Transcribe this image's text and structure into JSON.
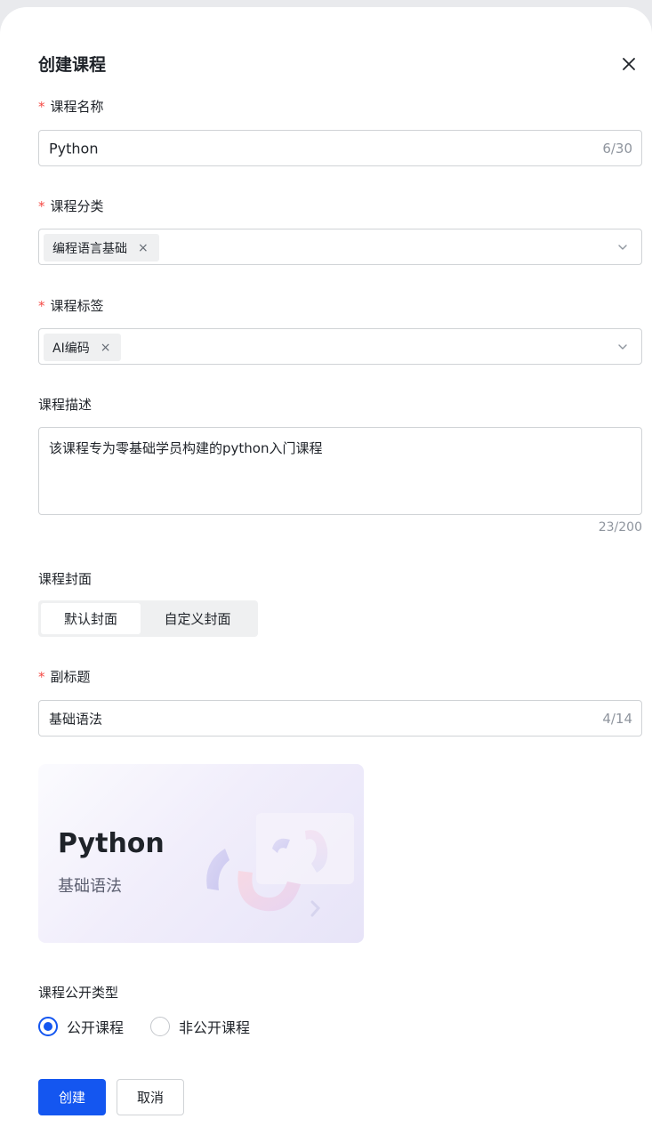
{
  "dialog": {
    "title": "创建课程",
    "close_icon": "close-icon"
  },
  "course_name": {
    "required_mark": "*",
    "label": "课程名称",
    "value": "Python",
    "count": "6/30"
  },
  "course_category": {
    "required_mark": "*",
    "label": "课程分类",
    "tag": "编程语言基础",
    "tag_close": "×"
  },
  "course_tags": {
    "required_mark": "*",
    "label": "课程标签",
    "tag": "AI编码",
    "tag_close": "×"
  },
  "course_description": {
    "label": "课程描述",
    "value": "该课程专为零基础学员构建的python入门课程",
    "count": "23/200"
  },
  "course_cover": {
    "label": "课程封面",
    "options": [
      "默认封面",
      "自定义封面"
    ],
    "selected": "默认封面"
  },
  "subtitle": {
    "required_mark": "*",
    "label": "副标题",
    "value": "基础语法",
    "count": "4/14"
  },
  "cover_preview": {
    "title": "Python",
    "subtitle": "基础语法"
  },
  "visibility": {
    "label": "课程公开类型",
    "options": [
      "公开课程",
      "非公开课程"
    ],
    "selected": "公开课程"
  },
  "actions": {
    "create": "创建",
    "cancel": "取消"
  },
  "colors": {
    "primary": "#1456f0",
    "required": "#f54a45"
  }
}
